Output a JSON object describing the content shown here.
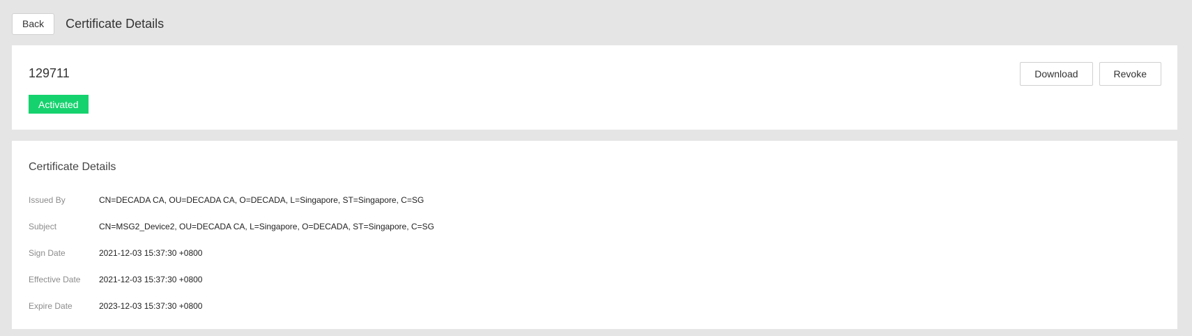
{
  "header": {
    "back_label": "Back",
    "title": "Certificate Details"
  },
  "summary": {
    "cert_id": "129711",
    "status": "Activated",
    "status_color": "#16d26e",
    "download_label": "Download",
    "revoke_label": "Revoke"
  },
  "details": {
    "section_title": "Certificate Details",
    "rows": [
      {
        "label": "Issued By",
        "value": "CN=DECADA CA, OU=DECADA CA, O=DECADA, L=Singapore, ST=Singapore, C=SG"
      },
      {
        "label": "Subject",
        "value": "CN=MSG2_Device2, OU=DECADA CA, L=Singapore, O=DECADA, ST=Singapore, C=SG"
      },
      {
        "label": "Sign Date",
        "value": "2021-12-03 15:37:30 +0800"
      },
      {
        "label": "Effective Date",
        "value": "2021-12-03 15:37:30 +0800"
      },
      {
        "label": "Expire Date",
        "value": "2023-12-03 15:37:30 +0800"
      }
    ]
  }
}
